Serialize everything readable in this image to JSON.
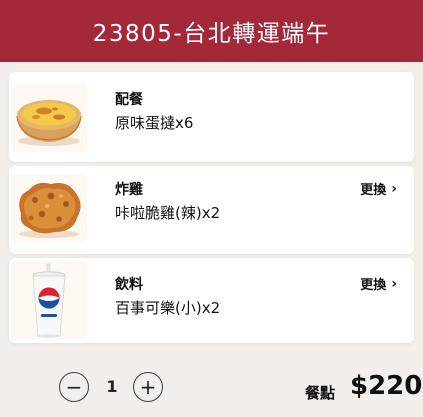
{
  "header": {
    "title": "23805-台北轉運端午"
  },
  "meal_items": [
    {
      "category": "配餐",
      "name": "原味蛋撻x6",
      "image_icon": "egg-tart-icon"
    },
    {
      "category": "炸雞",
      "name": "咔啦脆雞(辣)x2",
      "change_label": "更換",
      "chevron": "›",
      "image_icon": "fried-chicken-icon"
    },
    {
      "category": "飲料",
      "name": "百事可樂(小)x2",
      "change_label": "更換",
      "chevron": "›",
      "image_icon": "pepsi-cup-icon"
    }
  ],
  "quantity": {
    "minus": "−",
    "value": "1",
    "plus": "+"
  },
  "total": {
    "label": "餐點",
    "price": "$220"
  },
  "colors": {
    "header_bg": "#a2283a",
    "page_bg": "#f3eeea",
    "card_bg": "#ffffff"
  }
}
